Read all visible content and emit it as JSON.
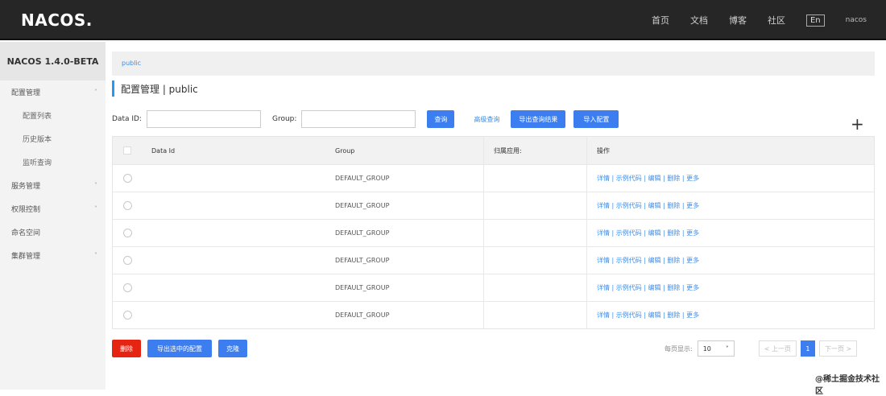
{
  "header": {
    "logo": "NACOS.",
    "nav": [
      "首页",
      "文档",
      "博客",
      "社区"
    ],
    "lang": "En",
    "user": "nacos"
  },
  "sidebar": {
    "title": "NACOS 1.4.0-BETA",
    "items": [
      {
        "label": "配置管理",
        "chevron": "˄",
        "sub": false
      },
      {
        "label": "配置列表",
        "chevron": "",
        "sub": true
      },
      {
        "label": "历史版本",
        "chevron": "",
        "sub": true
      },
      {
        "label": "监听查询",
        "chevron": "",
        "sub": true
      },
      {
        "label": "服务管理",
        "chevron": "˅",
        "sub": false
      },
      {
        "label": "权限控制",
        "chevron": "˅",
        "sub": false
      },
      {
        "label": "命名空间",
        "chevron": "",
        "sub": false
      },
      {
        "label": "集群管理",
        "chevron": "˅",
        "sub": false
      }
    ]
  },
  "namespace_bar": {
    "label": "public"
  },
  "page": {
    "title": "配置管理 | public",
    "description": ""
  },
  "filter": {
    "data_id_label": "Data ID:",
    "data_id_placeholder": "",
    "group_label": "Group:",
    "group_placeholder": "",
    "query_button": "查询",
    "advanced_link": "高级查询",
    "export_query_button": "导出查询结果",
    "import_button": "导入配置"
  },
  "add_icon": "plus-icon",
  "table": {
    "headers": [
      "Data Id",
      "Group",
      "归属应用:",
      "操作"
    ],
    "rows": [
      {
        "data_id": "",
        "group": "DEFAULT_GROUP",
        "app": "",
        "ops": "详情 | 示例代码 | 编辑 | 删除 | 更多"
      },
      {
        "data_id": "",
        "group": "DEFAULT_GROUP",
        "app": "",
        "ops": "详情 | 示例代码 | 编辑 | 删除 | 更多"
      },
      {
        "data_id": "",
        "group": "DEFAULT_GROUP",
        "app": "",
        "ops": "详情 | 示例代码 | 编辑 | 删除 | 更多"
      },
      {
        "data_id": "",
        "group": "DEFAULT_GROUP",
        "app": "",
        "ops": "详情 | 示例代码 | 编辑 | 删除 | 更多"
      },
      {
        "data_id": "",
        "group": "DEFAULT_GROUP",
        "app": "",
        "ops": "详情 | 示例代码 | 编辑 | 删除 | 更多"
      },
      {
        "data_id": "",
        "group": "DEFAULT_GROUP",
        "app": "",
        "ops": "详情 | 示例代码 | 编辑 | 删除 | 更多"
      }
    ]
  },
  "bottom_actions": {
    "delete_button": "删除",
    "export_selected_button": "导出选中的配置",
    "clone_button": "克隆"
  },
  "pager": {
    "size_label": "每页显示:",
    "size_value": "10",
    "size_chevron": "˅",
    "prev": "< 上一页",
    "current": "1",
    "next": "下一页 >"
  },
  "watermark": "@稀土掘金技术社区",
  "colors": {
    "accent": "#3c7ef0",
    "link": "#3c8de8",
    "danger": "#e62412",
    "topbar": "#262626"
  }
}
